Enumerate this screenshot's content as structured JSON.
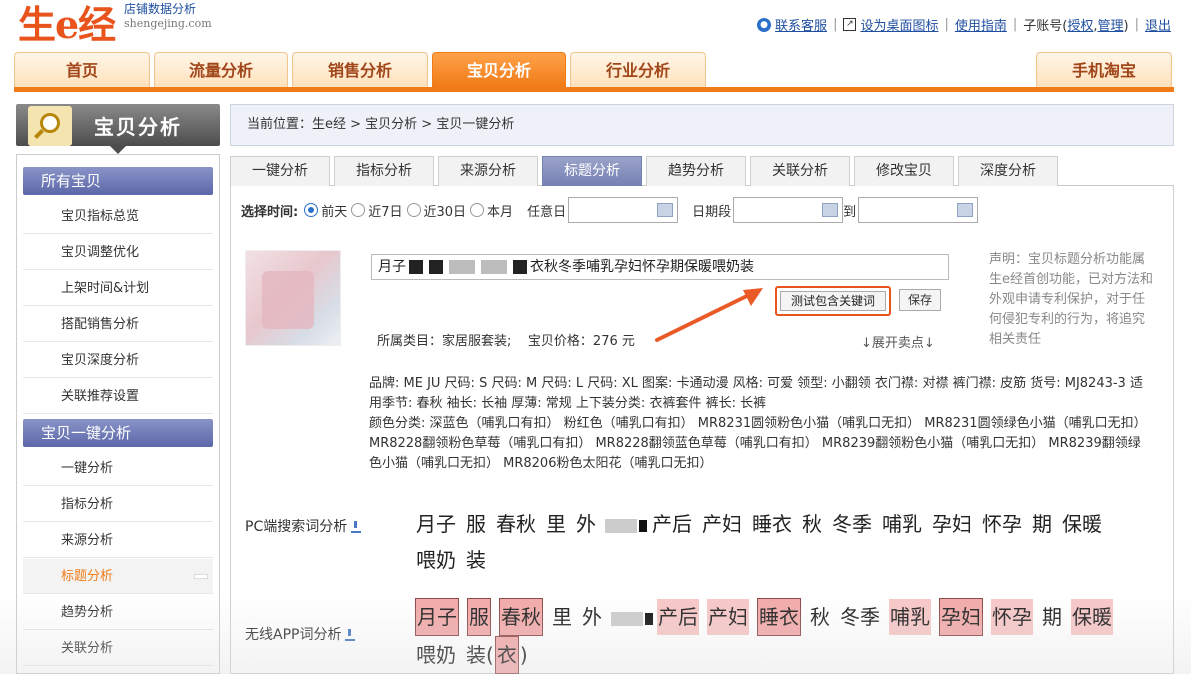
{
  "header": {
    "logo": "生e经",
    "logo_sub": "店铺数据分析",
    "logo_domain": "shengejing.com",
    "links": {
      "customer_service": "联系客服",
      "desktop_icon": "设为桌面图标",
      "guide": "使用指南",
      "sub_account_prefix": "子账号(",
      "authorize": "授权",
      "manage": "管理",
      "sub_account_suffix": ")",
      "logout": "退出"
    }
  },
  "main_nav": {
    "items": [
      "首页",
      "流量分析",
      "销售分析",
      "宝贝分析",
      "行业分析"
    ],
    "active": "宝贝分析",
    "mobile": "手机淘宝"
  },
  "sidebar": {
    "header": "宝贝分析",
    "groups": [
      {
        "title": "所有宝贝",
        "items": [
          "宝贝指标总览",
          "宝贝调整优化",
          "上架时间&计划",
          "搭配销售分析",
          "宝贝深度分析",
          "关联推荐设置"
        ]
      },
      {
        "title": "宝贝一键分析",
        "items": [
          "一键分析",
          "指标分析",
          "来源分析",
          "标题分析",
          "趋势分析",
          "关联分析"
        ]
      }
    ],
    "active_item": "标题分析"
  },
  "breadcrumb": "当前位置：生e经 > 宝贝分析 > 宝贝一键分析",
  "subtabs": {
    "items": [
      "一键分析",
      "指标分析",
      "来源分析",
      "标题分析",
      "趋势分析",
      "关联分析",
      "修改宝贝",
      "深度分析"
    ],
    "active": "标题分析"
  },
  "time_filter": {
    "label": "选择时间:",
    "options": [
      "前天",
      "近7日",
      "近30日",
      "本月"
    ],
    "selected": "前天",
    "any_day_label": "任意日",
    "period_label": "日期段",
    "to_label": "到"
  },
  "product": {
    "title_prefix": "月子",
    "title_suffix": "衣秋冬季哺乳孕妇怀孕期保暖喂奶装",
    "test_button": "测试包含关键词",
    "save_button": "保存",
    "category": "所属类目：家居服套装;",
    "price": "宝贝价格：276 元",
    "expand": "↓展开卖点↓"
  },
  "notice": "声明：宝贝标题分析功能属生e经首创功能，已对方法和外观申请专利保护，对于任何侵犯专利的行为，将追究相关责任",
  "attributes": {
    "line1": "品牌: ME JU  尺码: S  尺码: M  尺码: L  尺码: XL  图案: 卡通动漫  风格: 可爱  领型: 小翻领  衣门襟: 对襟  裤门襟: 皮筋  货号: MJ8243-3  适用季节: 春秋  袖长: 长袖  厚薄: 常规  上下装分类: 衣裤套件  裤长: 长裤",
    "line2": "颜色分类: 深蓝色（哺乳口有扣）  粉红色（哺乳口有扣）  MR8231圆领粉色小猫（哺乳口无扣）  MR8231圆领绿色小猫（哺乳口无扣）  MR8228翻领粉色草莓（哺乳口有扣）  MR8228翻领蓝色草莓（哺乳口有扣）  MR8239翻领粉色小猫（哺乳口无扣）  MR8239翻领绿色小猫（哺乳口无扣）  MR8206粉色太阳花（哺乳口无扣）"
  },
  "pc_words": {
    "label": "PC端搜索词分析",
    "words_a": [
      "月子",
      "服",
      "春秋",
      "里",
      "外"
    ],
    "words_b": [
      "产后",
      "产妇",
      "睡衣",
      "秋",
      "冬季",
      "哺乳",
      "孕妇",
      "怀孕",
      "期",
      "保暖",
      "喂奶",
      "装"
    ]
  },
  "app_words": {
    "label": "无线APP词分析",
    "words_a": [
      {
        "t": "月子",
        "s": "hl2"
      },
      {
        "t": "服",
        "s": "hl2"
      },
      {
        "t": "春秋",
        "s": "hl2"
      },
      {
        "t": "里",
        "s": ""
      },
      {
        "t": "外",
        "s": ""
      }
    ],
    "words_b": [
      {
        "t": "产后",
        "s": "hl"
      },
      {
        "t": "产妇",
        "s": "hl"
      },
      {
        "t": "睡衣",
        "s": "hl2"
      },
      {
        "t": "秋",
        "s": ""
      },
      {
        "t": "冬季",
        "s": ""
      },
      {
        "t": "哺乳",
        "s": "hl"
      },
      {
        "t": "孕妇",
        "s": "hl2"
      },
      {
        "t": "怀孕",
        "s": "hl"
      },
      {
        "t": "期",
        "s": ""
      },
      {
        "t": "保暖",
        "s": "hl"
      },
      {
        "t": "喂奶",
        "s": ""
      }
    ],
    "tail_open": "装(",
    "tail_word": "衣",
    "tail_close": ")"
  },
  "colors": {
    "accent": "#f07b17",
    "link": "#1f4fa0",
    "highlight": "#f7c7c7",
    "sidebar_group": "#6a75b4"
  }
}
